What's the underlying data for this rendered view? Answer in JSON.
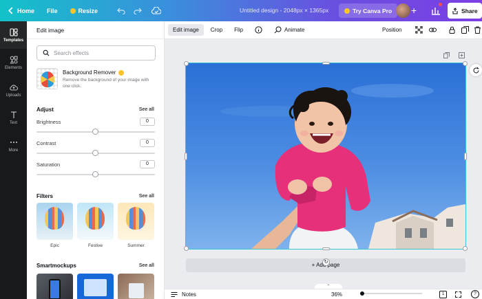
{
  "topbar": {
    "home_label": "Home",
    "file_label": "File",
    "resize_label": "Resize",
    "design_title": "Untitled design - 2048px × 1365px",
    "try_pro_label": "Try Canva Pro",
    "share_label": "Share"
  },
  "rail": {
    "items": [
      {
        "label": "Templates",
        "icon": "templates-icon"
      },
      {
        "label": "Elements",
        "icon": "elements-icon"
      },
      {
        "label": "Uploads",
        "icon": "uploads-icon"
      },
      {
        "label": "Text",
        "icon": "text-icon"
      },
      {
        "label": "More",
        "icon": "more-icon"
      }
    ]
  },
  "panel": {
    "title": "Edit image",
    "search_placeholder": "Search effects",
    "bg_remover": {
      "title": "Background Remover",
      "description": "Remove the background of your image with one click."
    },
    "adjust": {
      "title": "Adjust",
      "see_all": "See all",
      "sliders": [
        {
          "label": "Brightness",
          "value": "0",
          "level": 0.5
        },
        {
          "label": "Contrast",
          "value": "0",
          "level": 0.5
        },
        {
          "label": "Saturation",
          "value": "0",
          "level": 0.5
        }
      ]
    },
    "filters": {
      "title": "Filters",
      "see_all": "See all",
      "items": [
        "Epic",
        "Festive",
        "Summer"
      ]
    },
    "smartmockups": {
      "title": "Smartmockups",
      "see_all": "See all"
    }
  },
  "toolbar": {
    "edit_image": "Edit image",
    "crop": "Crop",
    "flip": "Flip",
    "animate": "Animate",
    "position": "Position"
  },
  "canvas": {
    "add_page": "+ Add page"
  },
  "bottombar": {
    "notes": "Notes",
    "zoom": "36%",
    "page_number": "1",
    "help": "?"
  },
  "colors": {
    "accent": "#7b3fe4",
    "selection": "#34c6d3",
    "rail_bg": "#18191b"
  }
}
